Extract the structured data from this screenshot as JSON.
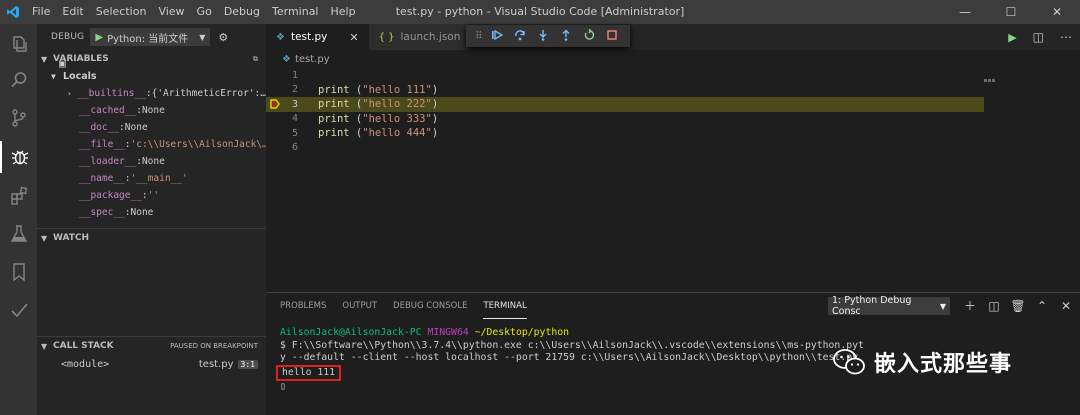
{
  "titlebar": {
    "menu": [
      "File",
      "Edit",
      "Selection",
      "View",
      "Go",
      "Debug",
      "Terminal",
      "Help"
    ],
    "title": "test.py - python - Visual Studio Code [Administrator]",
    "minimize": "—",
    "maximize": "☐",
    "close": "✕"
  },
  "activity_icons": [
    "files-icon",
    "search-icon",
    "source-control-icon",
    "debug-icon",
    "extensions-icon",
    "test-flask-icon",
    "bookmark-icon",
    "check-icon"
  ],
  "sidebar": {
    "debug_label": "DEBUG",
    "config_name": "Python: 当前文件",
    "variables_header": "VARIABLES",
    "locals_label": "Locals",
    "variables": [
      {
        "name": "__builtins__",
        "value": "{'ArithmeticError':…",
        "expandable": true
      },
      {
        "name": "__cached__",
        "value": "None"
      },
      {
        "name": "__doc__",
        "value": "None"
      },
      {
        "name": "__file__",
        "value": "'c:\\\\Users\\\\AilsonJack\\…",
        "string": true
      },
      {
        "name": "__loader__",
        "value": "None"
      },
      {
        "name": "__name__",
        "value": "'__main__'",
        "string": true
      },
      {
        "name": "__package__",
        "value": "''",
        "string": true
      },
      {
        "name": "__spec__",
        "value": "None"
      }
    ],
    "watch_header": "WATCH",
    "callstack_header": "CALL STACK",
    "callstack_status": "PAUSED ON BREAKPOINT",
    "frames": [
      {
        "name": "<module>",
        "file": "test.py",
        "line": "3:1"
      }
    ]
  },
  "tabs": [
    {
      "label": "test.py",
      "icon": "python-file-icon",
      "active": true,
      "close": "✕"
    },
    {
      "label": "launch.json",
      "icon": "json-file-icon",
      "active": false
    }
  ],
  "breadcrumb": "test.py",
  "code": {
    "current_line": 3,
    "lines": [
      {
        "num": "1",
        "fn": "",
        "arg": ""
      },
      {
        "num": "2",
        "fn": "print",
        "arg": "\"hello 111\""
      },
      {
        "num": "3",
        "fn": "print",
        "arg": "\"hello 222\""
      },
      {
        "num": "4",
        "fn": "print",
        "arg": "\"hello 333\""
      },
      {
        "num": "5",
        "fn": "print",
        "arg": "\"hello 444\""
      },
      {
        "num": "6",
        "fn": "",
        "arg": ""
      }
    ]
  },
  "panel": {
    "tabs": [
      "PROBLEMS",
      "OUTPUT",
      "DEBUG CONSOLE",
      "TERMINAL"
    ],
    "active_tab": "TERMINAL",
    "terminal_select": "1: Python Debug Consc",
    "terminal": {
      "user": "AilsonJack@AilsonJack-PC",
      "shell": "MINGW64",
      "path": "~/Desktop/python",
      "cmd1": "$ F:\\\\Software\\\\Python\\\\3.7.4\\\\python.exe c:\\\\Users\\\\AilsonJack\\\\.vscode\\\\extensions\\\\ms-python.pyt",
      "cmd2": "y --default --client --host localhost --port 21759 c:\\\\Users\\\\AilsonJack\\\\Desktop\\\\python\\\\test.py",
      "output": "hello 111",
      "cursor": "▯"
    }
  },
  "watermark": "嵌入式那些事",
  "colors": {
    "accent": "#007acc",
    "current_line": "#4b4a1a",
    "highlight_box": "#e02020"
  }
}
